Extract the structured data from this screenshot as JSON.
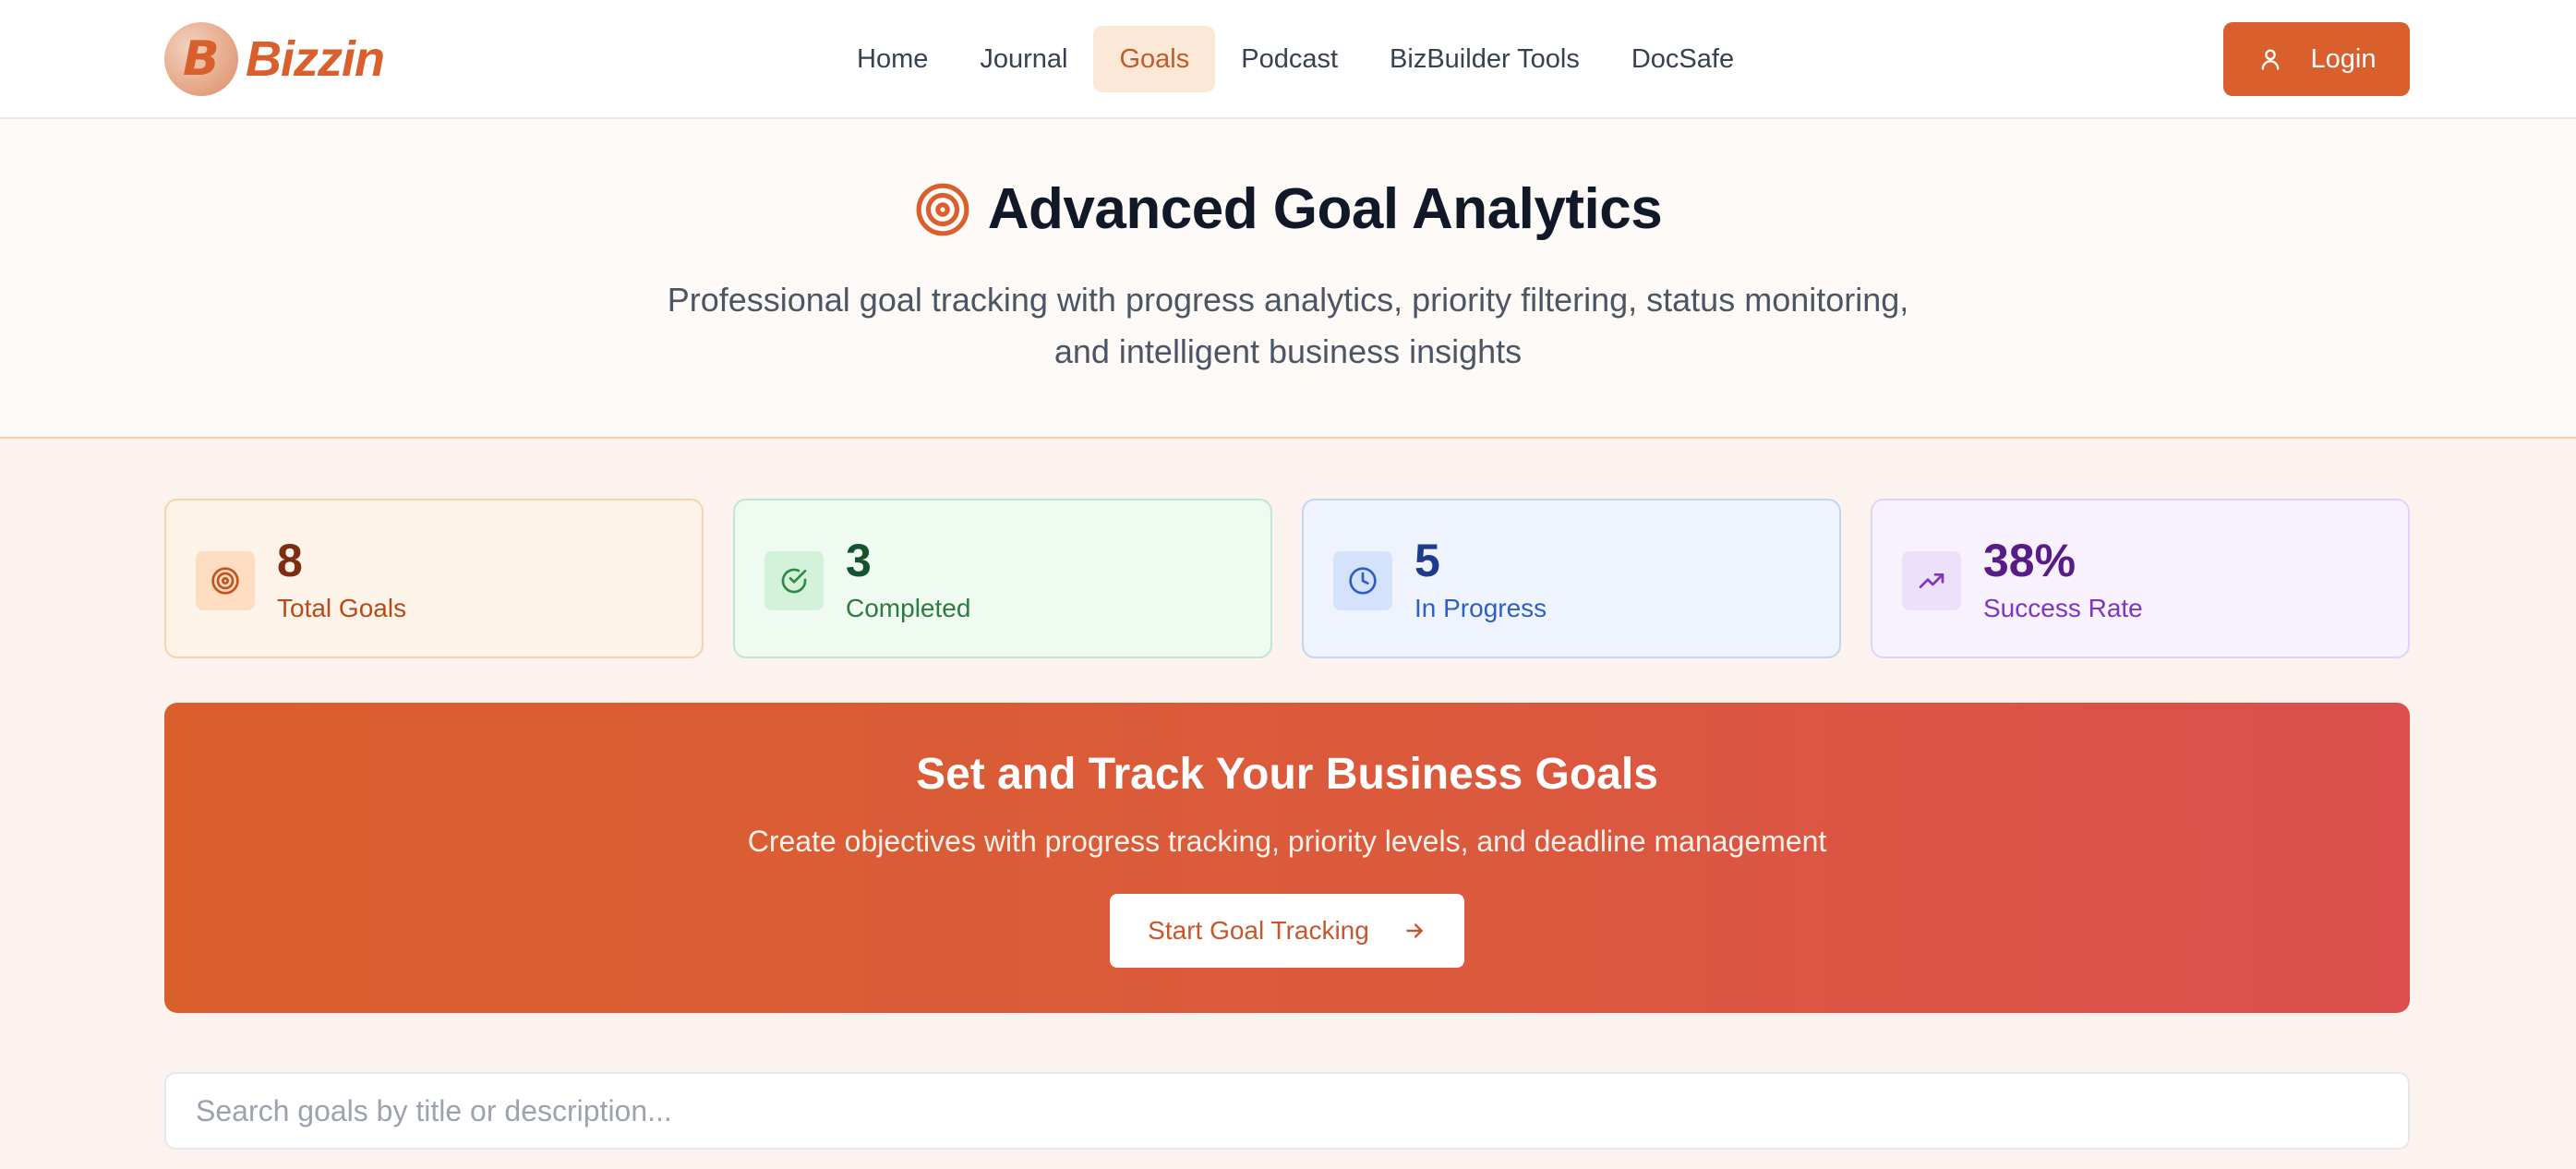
{
  "brand": {
    "name": "Bizzin",
    "letter": "B",
    "accent": "#d9602d"
  },
  "nav": {
    "items": [
      {
        "label": "Home"
      },
      {
        "label": "Journal"
      },
      {
        "label": "Goals",
        "active": true
      },
      {
        "label": "Podcast"
      },
      {
        "label": "BizBuilder Tools"
      },
      {
        "label": "DocSafe"
      }
    ],
    "login_label": "Login"
  },
  "hero": {
    "title": "Advanced Goal Analytics",
    "subtitle": "Professional goal tracking with progress analytics, priority filtering, status monitoring, and intelligent business insights"
  },
  "stats": [
    {
      "value": "8",
      "label": "Total Goals",
      "icon": "target-icon"
    },
    {
      "value": "3",
      "label": "Completed",
      "icon": "check-circle-icon"
    },
    {
      "value": "5",
      "label": "In Progress",
      "icon": "clock-icon"
    },
    {
      "value": "38%",
      "label": "Success Rate",
      "icon": "trending-up-icon"
    }
  ],
  "cta": {
    "title": "Set and Track Your Business Goals",
    "subtitle": "Create objectives with progress tracking, priority levels, and deadline management",
    "button_label": "Start Goal Tracking"
  },
  "search": {
    "placeholder": "Search goals by title or description...",
    "value": ""
  }
}
